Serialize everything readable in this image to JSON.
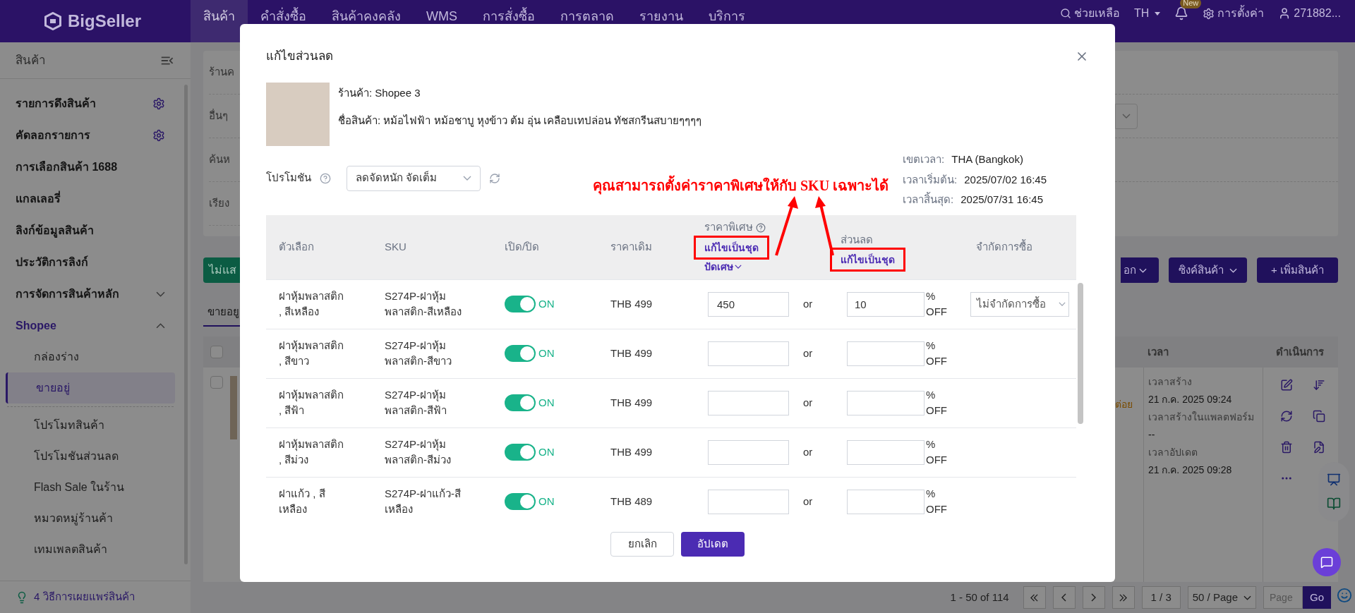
{
  "nav": {
    "logo": "BigSeller",
    "menu": [
      {
        "label": "สินค้า",
        "selected": true
      },
      {
        "label": "คำสั่งซื้อ",
        "selected": false
      },
      {
        "label": "สินค้าคงคลัง",
        "selected": false
      },
      {
        "label": "WMS",
        "selected": false
      },
      {
        "label": "การสั่งซื้อ",
        "selected": false
      },
      {
        "label": "การตลาด",
        "selected": false
      },
      {
        "label": "รายงาน",
        "selected": false
      },
      {
        "label": "บริการ",
        "selected": false
      }
    ],
    "help": "ช่วยเหลือ",
    "language": "TH",
    "badge": "New",
    "settings": "การตั้งค่า",
    "user": "271882..."
  },
  "sidebar": {
    "title": "สินค้า",
    "items": [
      {
        "kind": "setting",
        "label": "รายการดึงสินค้า"
      },
      {
        "kind": "setting",
        "label": "คัดลอกรายการ"
      },
      {
        "kind": "plain",
        "label": "การเลือกสินค้า 1688"
      },
      {
        "kind": "plain",
        "label": "แกลเลอรี่"
      },
      {
        "kind": "plain",
        "label": "ลิงก์ข้อมูลสินค้า"
      },
      {
        "kind": "plain",
        "label": "ประวัติการลิงก์"
      },
      {
        "kind": "group",
        "label": "การจัดการสินค้าหลัก",
        "expanded": false
      },
      {
        "kind": "group",
        "label": "Shopee",
        "expanded": true,
        "children": [
          {
            "kind": "item",
            "label": "กล่องร่าง",
            "selected": false
          },
          {
            "kind": "item",
            "label": "ขายอยู่",
            "selected": true
          },
          {
            "kind": "divider"
          },
          {
            "kind": "item",
            "label": "โปรโมทสินค้า",
            "selected": false
          },
          {
            "kind": "item",
            "label": "โปรโมชันส่วนลด",
            "selected": false
          },
          {
            "kind": "item",
            "label": "Flash Sale ในร้าน",
            "selected": false
          },
          {
            "kind": "item",
            "label": "หมวดหมู่ร้านค้า",
            "selected": false
          },
          {
            "kind": "item",
            "label": "เทมเพลตสินค้า",
            "selected": false
          }
        ]
      }
    ],
    "footer": "4 วิธีการเผยแพร่สินค้า"
  },
  "page": {
    "filter_labels": [
      "ร้านค",
      "อื่นๆ",
      "ค้นห",
      "เรียง"
    ],
    "hide_button": "ไม่แส",
    "more_button": "อก",
    "sync_button": "ซิงค์สินค้า",
    "add_button": "+ เพิ่มสินค้า",
    "tab": {
      "label": "ขายอยู",
      "selected": true
    },
    "checkboxes": [
      {
        "checked": false
      },
      {
        "checked": false
      }
    ],
    "columns": [
      "เวลา",
      "ดำเนินการ"
    ],
    "status_fragment": "ต่อย",
    "times": [
      "เวลาสร้าง",
      "21 ก.ค. 2025 09:24",
      "เวลาสร้างในแพลตฟอร์ม",
      "--",
      "เวลาอัปเดต",
      "21 ก.ค. 2025 09:28"
    ],
    "pagination": {
      "range": "1 - 50 of 114",
      "page": "1 / 3",
      "page_size": "50 / Page",
      "jump_placeholder": "Page",
      "go": "Go"
    }
  },
  "modal": {
    "title": "แก้ไขส่วนลด",
    "store": "ร้านค้า: Shopee 3",
    "product": "ชื่อสินค้า: หม้อไฟฟ้า หม้อชาบู หุงข้าว ต้ม อุ่น เคลือบเทปล่อน ทัชสกรีนสบายๆๆๆๆ",
    "promotion": {
      "label": "โปรโมชัน",
      "value": "ลดจัดหนัก จัดเต็ม"
    },
    "info": [
      {
        "label": "เขตเวลา:",
        "value": "THA (Bangkok)"
      },
      {
        "label": "เวลาเริ่มต้น:",
        "value": "2025/07/02 16:45"
      },
      {
        "label": "เวลาสิ้นสุด:",
        "value": "2025/07/31 16:45"
      }
    ],
    "annotation": "คุณสามารถตั้งค่าราคาพิเศษให้กับ SKU เฉพาะได้",
    "columns": [
      {
        "kind": "plain",
        "label": "ตัวเลือก"
      },
      {
        "kind": "plain",
        "label": "SKU"
      },
      {
        "kind": "plain",
        "label": "เปิด/ปิด"
      },
      {
        "kind": "plain",
        "label": "ราคาเดิม"
      },
      {
        "kind": "price",
        "label": "ราคาพิเศษ",
        "batch_edit": "แก้ไขเป็นชุด",
        "highlighted": true,
        "rounding": "ปัดเศษ"
      },
      {
        "kind": "discount",
        "label": "ส่วนลด",
        "batch_edit": "แก้ไขเป็นชุด",
        "highlighted": true
      },
      {
        "kind": "plain",
        "label": "จำกัดการซื้อ"
      }
    ],
    "rows": [
      {
        "option": "ฝาหุ้มพลาสติก , สีเหลือง",
        "sku": "S274P-ฝาหุ้มพลาสติก-สีเหลือง",
        "on": true,
        "status": "ON",
        "price": "THB 499",
        "special_price": "450",
        "or": "or",
        "discount": "10",
        "off": "% OFF",
        "limit": "ไม่จำกัดการซื้อ"
      },
      {
        "option": "ฝาหุ้มพลาสติก , สีขาว",
        "sku": "S274P-ฝาหุ้มพลาสติก-สีขาว",
        "on": true,
        "status": "ON",
        "price": "THB 499",
        "or": "or",
        "off": "% OFF"
      },
      {
        "option": "ฝาหุ้มพลาสติก , สีฟ้า",
        "sku": "S274P-ฝาหุ้มพลาสติก-สีฟ้า",
        "on": true,
        "status": "ON",
        "price": "THB 499",
        "or": "or",
        "off": "% OFF"
      },
      {
        "option": "ฝาหุ้มพลาสติก , สีม่วง",
        "sku": "S274P-ฝาหุ้มพลาสติก-สีม่วง",
        "on": true,
        "status": "ON",
        "price": "THB 499",
        "or": "or",
        "off": "% OFF"
      },
      {
        "option": "ฝาแก้ว , สีเหลือง",
        "sku": "S274P-ฝาแก้ว-สีเหลือง",
        "on": true,
        "status": "ON",
        "price": "THB 489",
        "or": "or",
        "off": "% OFF"
      }
    ],
    "cancel": "ยกเลิก",
    "submit": "อัปเดต"
  }
}
